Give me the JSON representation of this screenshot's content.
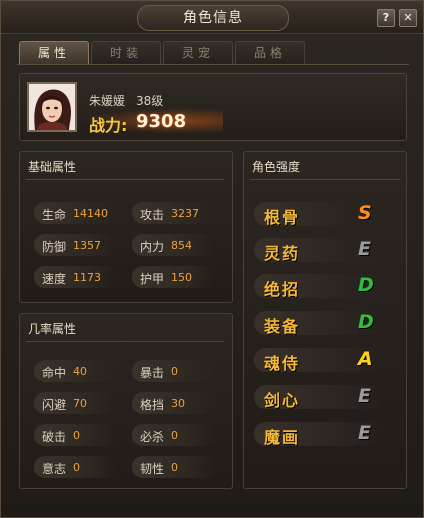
{
  "window": {
    "title": "角色信息",
    "help_label": "?",
    "close_label": "✕"
  },
  "tabs": [
    {
      "label": "属性",
      "active": true
    },
    {
      "label": "时装",
      "active": false
    },
    {
      "label": "灵宠",
      "active": false
    },
    {
      "label": "品格",
      "active": false
    }
  ],
  "character": {
    "name": "朱媛媛",
    "level": "38级",
    "power_label": "战力:",
    "power_value": "9308"
  },
  "basic": {
    "title": "基础属性",
    "rows": [
      [
        {
          "label": "生命",
          "value": "14140"
        },
        {
          "label": "攻击",
          "value": "3237"
        }
      ],
      [
        {
          "label": "防御",
          "value": "1357"
        },
        {
          "label": "内力",
          "value": "854"
        }
      ],
      [
        {
          "label": "速度",
          "value": "1173"
        },
        {
          "label": "护甲",
          "value": "150"
        }
      ]
    ]
  },
  "rate": {
    "title": "几率属性",
    "rows": [
      [
        {
          "label": "命中",
          "value": "40"
        },
        {
          "label": "暴击",
          "value": "0"
        }
      ],
      [
        {
          "label": "闪避",
          "value": "70"
        },
        {
          "label": "格挡",
          "value": "30"
        }
      ],
      [
        {
          "label": "破击",
          "value": "0"
        },
        {
          "label": "必杀",
          "value": "0"
        }
      ],
      [
        {
          "label": "意志",
          "value": "0"
        },
        {
          "label": "韧性",
          "value": "0"
        }
      ]
    ]
  },
  "strength": {
    "title": "角色强度",
    "items": [
      {
        "label": "根骨",
        "grade": "S",
        "color": "#ff8c1a"
      },
      {
        "label": "灵药",
        "grade": "E",
        "color": "#9a9a9a"
      },
      {
        "label": "绝招",
        "grade": "D",
        "color": "#2fbf3a"
      },
      {
        "label": "装备",
        "grade": "D",
        "color": "#2fbf3a"
      },
      {
        "label": "魂侍",
        "grade": "A",
        "color": "#ffd21a"
      },
      {
        "label": "剑心",
        "grade": "E",
        "color": "#9a9a9a"
      },
      {
        "label": "魔画",
        "grade": "E",
        "color": "#9a9a9a"
      }
    ]
  },
  "icons": {
    "portrait": "character-portrait",
    "help": "help-icon",
    "close": "close-icon"
  }
}
